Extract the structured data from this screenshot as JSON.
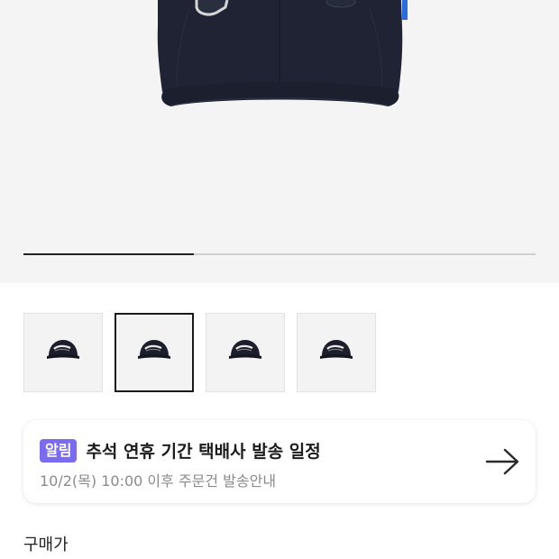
{
  "gallery": {
    "image_alt": "navy baseball cap",
    "progress_fraction": 0.333,
    "thumbnail_count": 4,
    "selected_index": 1,
    "colors": {
      "track": "#cfcfcf",
      "fill": "#222222",
      "cap": "#1f2333"
    }
  },
  "notice": {
    "badge": "알림",
    "title": "추석 연휴 기간 택배사 발송 일정",
    "subtitle": "10/2(목) 10:00 이후 주문건 발송안내",
    "arrow_icon": "arrow-right-icon",
    "badge_color": "#7a6bf0"
  },
  "price": {
    "label": "구매가"
  }
}
